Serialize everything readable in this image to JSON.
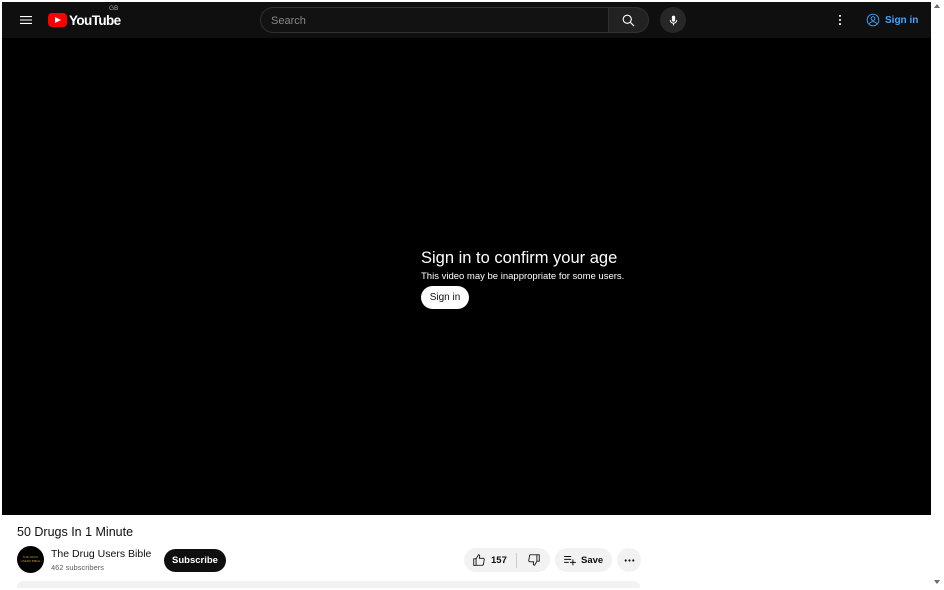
{
  "masthead": {
    "logo_text": "YouTube",
    "country_code": "GB",
    "search_placeholder": "Search",
    "sign_in_label": "Sign in",
    "icons": {
      "menu": "hamburger-menu-icon",
      "search": "search-icon",
      "mic": "microphone-icon",
      "more": "more-vertical-icon",
      "account": "account-circle-icon"
    }
  },
  "player": {
    "age_heading": "Sign in to confirm your age",
    "age_message": "This video may be inappropriate for some users.",
    "sign_in_button": "Sign in"
  },
  "video": {
    "title": "50 Drugs In 1 Minute",
    "channel_name": "The Drug Users Bible",
    "subscribers": "462 subscribers",
    "avatar_text": "THE DRUG USERS BIBLE",
    "subscribe_label": "Subscribe",
    "like_count": "157",
    "save_label": "Save"
  },
  "colors": {
    "masthead_bg": "#0f0f0f",
    "brand_red": "#ff0000",
    "link_blue": "#3ea6ff",
    "player_bg": "#000000"
  }
}
